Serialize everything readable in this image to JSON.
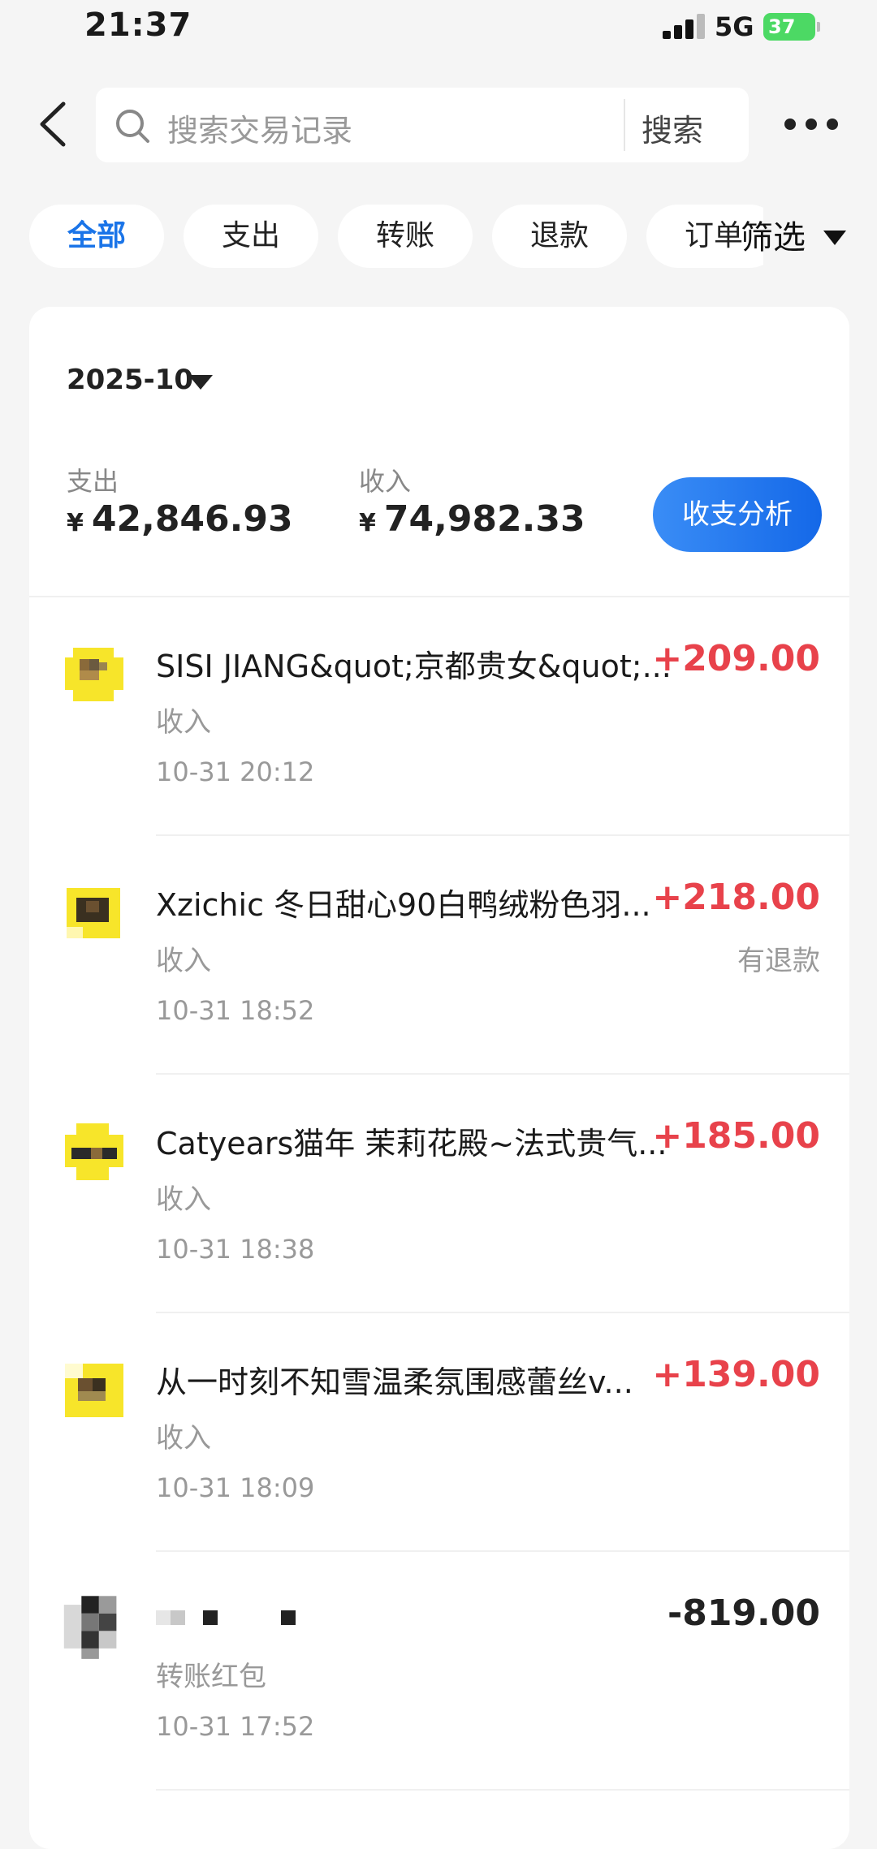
{
  "status_bar": {
    "time": "21:37",
    "network": "5G",
    "battery": "37"
  },
  "search": {
    "placeholder": "搜索交易记录",
    "button": "搜索"
  },
  "filters": {
    "chips": [
      "全部",
      "支出",
      "转账",
      "退款",
      "订单"
    ],
    "active": "全部",
    "filter_label": "筛选"
  },
  "summary": {
    "month": "2025-10",
    "expense_label": "支出",
    "expense_currency": "¥",
    "expense_value": "42,846.93",
    "income_label": "收入",
    "income_currency": "¥",
    "income_value": "74,982.33",
    "analysis_button": "收支分析"
  },
  "transactions": [
    {
      "title": "SISI JIANG&quot;京都贵女&quot;...",
      "amount": "+209.00",
      "kind": "收入",
      "tag": "",
      "time": "10-31 20:12"
    },
    {
      "title": "Xzichic 冬日甜心90白鸭绒粉色羽...",
      "amount": "+218.00",
      "kind": "收入",
      "tag": "有退款",
      "time": "10-31 18:52"
    },
    {
      "title": "Catyears猫年 茉莉花殿~法式贵气...",
      "amount": "+185.00",
      "kind": "收入",
      "tag": "",
      "time": "10-31 18:38"
    },
    {
      "title": "从一时刻不知雪温柔氛围感蕾丝v...",
      "amount": "+139.00",
      "kind": "收入",
      "tag": "",
      "time": "10-31 18:09"
    },
    {
      "title": "",
      "amount": "-819.00",
      "kind": "转账红包",
      "tag": "",
      "time": "10-31 17:52"
    }
  ],
  "colors": {
    "accent": "#1a74e8",
    "income": "#e8424b",
    "background": "#f5f5f5"
  }
}
